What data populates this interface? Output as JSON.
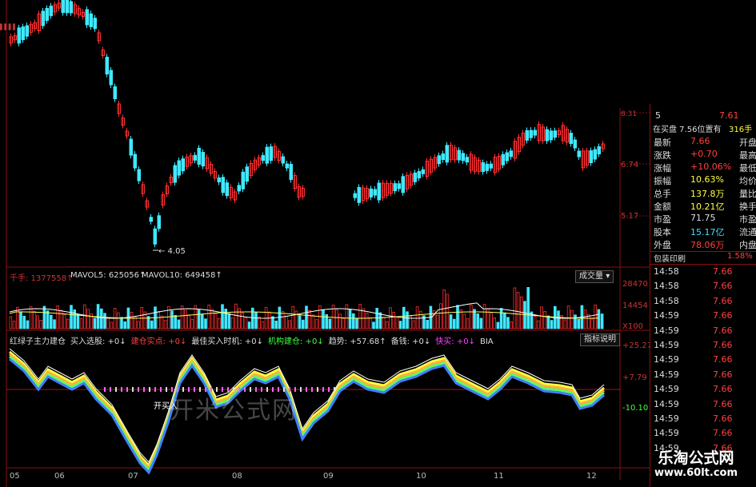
{
  "price_panel": {
    "low_label": "← 4.05",
    "right_axis": [
      "6.74",
      "5.17"
    ],
    "right_axis_top": "8.31"
  },
  "volume_panel": {
    "label_hand": "千手: 1377558↑",
    "mavol5": "MAVOL5: 625056↑",
    "mavol10": "MAVOL10: 649458↑",
    "button": "成交量",
    "axis": [
      "28470",
      "14454",
      "X100"
    ]
  },
  "indicator_panel": {
    "items": [
      {
        "text": "红绿子主力建仓",
        "color": "#dddddd"
      },
      {
        "text": "买入选股: +0↓",
        "color": "#dddddd"
      },
      {
        "text": "建仓实点: +0↓",
        "color": "#ff4040"
      },
      {
        "text": "最佳买入时机: +0↓",
        "color": "#dddddd"
      },
      {
        "text": "机构建仓: +0↓",
        "color": "#40ff40"
      },
      {
        "text": "趋势: +57.68↑",
        "color": "#dddddd"
      },
      {
        "text": "备钱: +0↓",
        "color": "#dddddd"
      },
      {
        "text": "快买: +0↓",
        "color": "#ff40ff"
      },
      {
        "text": "BIA",
        "color": "#dddddd"
      }
    ],
    "button": "指标说明",
    "axis": [
      "+25.27",
      "+7.79",
      "-10.10"
    ],
    "annotation": "开买入"
  },
  "watermark": "开米公式网",
  "x_axis": [
    "05",
    "06",
    "07",
    "08",
    "09",
    "10",
    "11",
    "12"
  ],
  "sidebar": {
    "top_price": "7.61",
    "top_left": "5",
    "status": "在买盘 7.56位置有",
    "status_right": "316手",
    "rows": [
      {
        "l": "最新",
        "v": "7.66",
        "r": "开盘",
        "vc": "#ff4040"
      },
      {
        "l": "涨跌",
        "v": "+0.70",
        "r": "最高",
        "vc": "#ff4040"
      },
      {
        "l": "涨幅",
        "v": "+10.06%",
        "r": "最低",
        "vc": "#ff4040"
      },
      {
        "l": "振幅",
        "v": "10.63%",
        "r": "均价",
        "vc": "#ffff40"
      },
      {
        "l": "总手",
        "v": "137.8万",
        "r": "量比",
        "vc": "#ffff40"
      },
      {
        "l": "金额",
        "v": "10.21亿",
        "r": "换手",
        "vc": "#ffff40"
      },
      {
        "l": "市盈",
        "v": "71.75",
        "r": "市盈",
        "vc": "#dddddd"
      },
      {
        "l": "股本",
        "v": "15.17亿",
        "r": "流通",
        "vc": "#40e0ff"
      },
      {
        "l": "外盘",
        "v": "78.06万",
        "r": "内盘",
        "vc": "#ff4040"
      }
    ],
    "package": "包装印刷",
    "package_pct": "1.58%",
    "ticks": [
      [
        "14:58",
        "7.66"
      ],
      [
        "14:58",
        "7.66"
      ],
      [
        "14:58",
        "7.66"
      ],
      [
        "14:59",
        "7.66"
      ],
      [
        "14:59",
        "7.66"
      ],
      [
        "14:59",
        "7.66"
      ],
      [
        "14:59",
        "7.66"
      ],
      [
        "14:59",
        "7.66"
      ],
      [
        "14:59",
        "7.66"
      ],
      [
        "14:59",
        "7.66"
      ],
      [
        "14:59",
        "7.66"
      ],
      [
        "14:59",
        "7.66"
      ],
      [
        "14:59",
        "7.66"
      ],
      [
        "14:59",
        "7.66"
      ]
    ]
  },
  "brand": {
    "name": "乐淘公式网",
    "url": "www.60lt.com"
  },
  "colors": {
    "up": "#ff3030",
    "down": "#40e8ff",
    "grid": "#8a1010"
  }
}
